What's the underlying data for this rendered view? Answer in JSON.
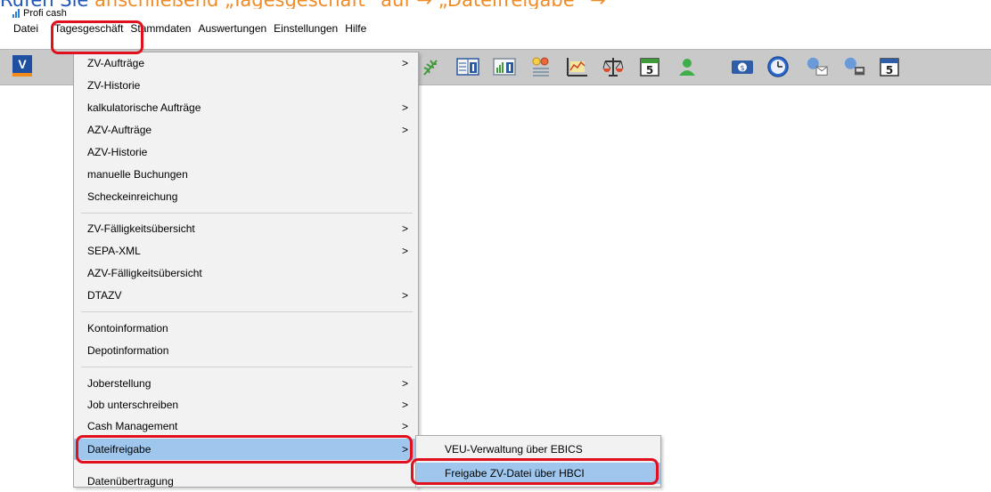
{
  "banner": {
    "part1": "Rufen Sie",
    "part2": "anschließend „Tagesgeschäft“ auf → „Dateifreigabe“ →"
  },
  "window": {
    "title": "Profi cash"
  },
  "menubar": {
    "items": [
      {
        "label": "Datei"
      },
      {
        "label": "Tagesgeschäft"
      },
      {
        "label": "Stammdaten"
      },
      {
        "label": "Auswertungen"
      },
      {
        "label": "Einstellungen"
      },
      {
        "label": "Hilfe"
      }
    ]
  },
  "toolbar": {
    "logo_text": "V",
    "calendar_day": "5",
    "icons": [
      "vr-bank-logo-icon",
      "plant-icon",
      "info-book-icon",
      "info-chart-icon",
      "coins-icon",
      "line-chart-icon",
      "scales-icon",
      "calendar-icon",
      "user-icon",
      "money-icon",
      "clock-icon",
      "mail-transfer-icon",
      "package-transfer-icon",
      "calendar-icon-2"
    ]
  },
  "menu": {
    "items": [
      {
        "label": "ZV-Aufträge",
        "arrow": ">"
      },
      {
        "label": "ZV-Historie",
        "arrow": ""
      },
      {
        "label": "kalkulatorische Aufträge",
        "arrow": ">"
      },
      {
        "label": "AZV-Aufträge",
        "arrow": ">"
      },
      {
        "label": "AZV-Historie",
        "arrow": ""
      },
      {
        "label": "manuelle Buchungen",
        "arrow": ""
      },
      {
        "label": "Scheckeinreichung",
        "arrow": ""
      },
      {
        "label": "ZV-Fälligkeitsübersicht",
        "arrow": ">"
      },
      {
        "label": "SEPA-XML",
        "arrow": ">"
      },
      {
        "label": "AZV-Fälligkeitsübersicht",
        "arrow": ""
      },
      {
        "label": "DTAZV",
        "arrow": ">"
      },
      {
        "label": "Kontoinformation",
        "arrow": ""
      },
      {
        "label": "Depotinformation",
        "arrow": ""
      },
      {
        "label": "Joberstellung",
        "arrow": ">"
      },
      {
        "label": "Job unterschreiben",
        "arrow": ">"
      },
      {
        "label": "Cash Management",
        "arrow": ">"
      },
      {
        "label": "Dateifreigabe",
        "arrow": ">"
      },
      {
        "label": "Datenübertragung",
        "arrow": ""
      }
    ]
  },
  "submenu": {
    "items": [
      {
        "label": "VEU-Verwaltung über EBICS"
      },
      {
        "label": "Freigabe ZV-Datei über HBCI"
      }
    ]
  },
  "colors": {
    "highlight": "#9fc7ee",
    "annotation_red": "#e0101e",
    "toolbar_bg": "#c9c9c9"
  }
}
